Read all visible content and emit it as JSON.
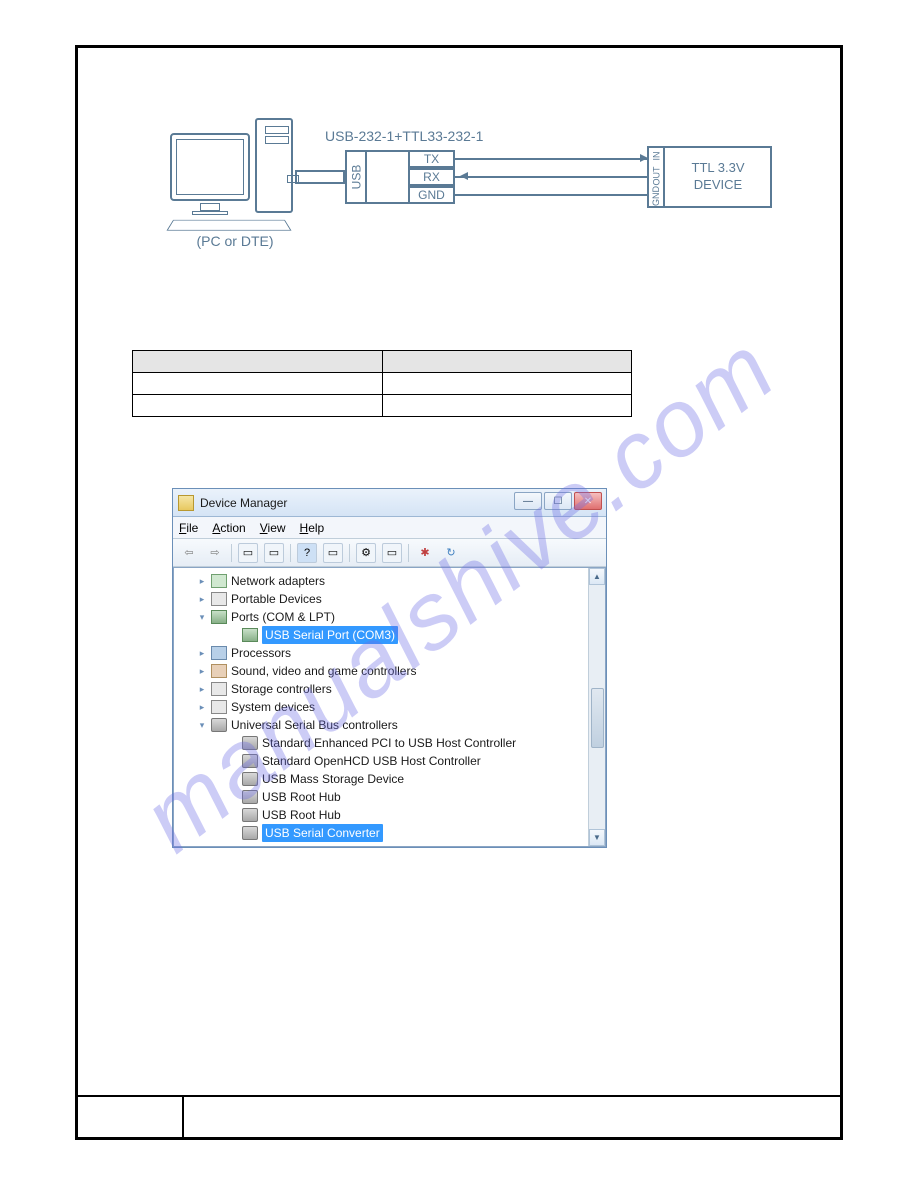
{
  "diagram": {
    "title": "USB-232-1+TTL33-232-1",
    "pc_caption": "(PC or DTE)",
    "usb_side": "USB",
    "pins": {
      "tx": "TX",
      "rx": "RX",
      "gnd": "GND"
    },
    "dev_pins": {
      "in": "IN",
      "out": "OUT",
      "gnd": "GND"
    },
    "device_label": "TTL 3.3V DEVICE"
  },
  "device_manager": {
    "title": "Device Manager",
    "menu": [
      "File",
      "Action",
      "View",
      "Help"
    ],
    "tree": {
      "net": "Network adapters",
      "portable": "Portable Devices",
      "ports": "Ports (COM & LPT)",
      "serial_port": "USB Serial Port (COM3)",
      "proc": "Processors",
      "sound": "Sound, video and game controllers",
      "storage": "Storage controllers",
      "system": "System devices",
      "usb": "Universal Serial Bus controllers",
      "usb_items": [
        "Standard Enhanced PCI to USB Host Controller",
        "Standard OpenHCD USB Host Controller",
        "USB Mass Storage Device",
        "USB Root Hub",
        "USB Root Hub",
        "USB Serial Converter"
      ]
    }
  },
  "watermark": "manualshive.com"
}
